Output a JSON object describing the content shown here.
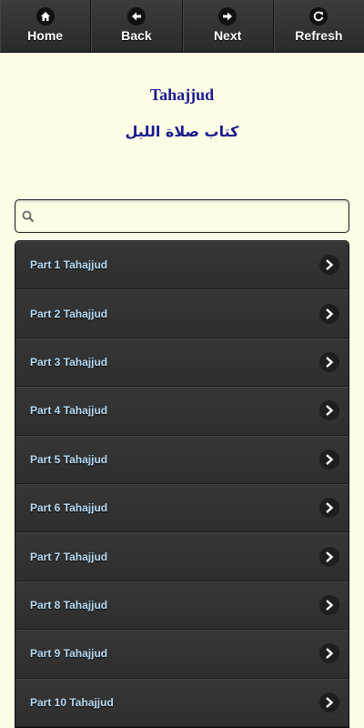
{
  "navbar": {
    "buttons": [
      {
        "label": "Home",
        "icon": "home-icon"
      },
      {
        "label": "Back",
        "icon": "arrow-left-icon"
      },
      {
        "label": "Next",
        "icon": "arrow-right-icon"
      },
      {
        "label": "Refresh",
        "icon": "refresh-icon"
      }
    ]
  },
  "header": {
    "title": "Tahajjud",
    "subtitle": "كتاب صلاة الليل"
  },
  "search": {
    "value": "",
    "placeholder": ""
  },
  "list": {
    "items": [
      {
        "label": "Part 1 Tahajjud"
      },
      {
        "label": "Part 2 Tahajjud"
      },
      {
        "label": "Part 3 Tahajjud"
      },
      {
        "label": "Part 4 Tahajjud"
      },
      {
        "label": "Part 5 Tahajjud"
      },
      {
        "label": "Part 6 Tahajjud"
      },
      {
        "label": "Part 7 Tahajjud"
      },
      {
        "label": "Part 8 Tahajjud"
      },
      {
        "label": "Part 9 Tahajjud"
      },
      {
        "label": "Part 10 Tahajjud"
      }
    ]
  },
  "colors": {
    "background": "#fffde6",
    "header_text": "#1a1a8c",
    "navbar": "#2b2b2b",
    "list_item": "#333333",
    "list_label": "#b8dcf5"
  }
}
